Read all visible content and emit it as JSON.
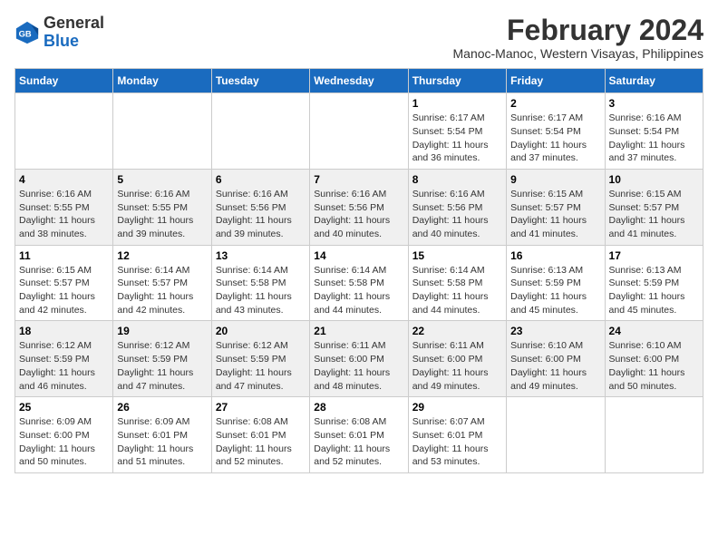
{
  "logo": {
    "general": "General",
    "blue": "Blue"
  },
  "header": {
    "month_year": "February 2024",
    "location": "Manoc-Manoc, Western Visayas, Philippines"
  },
  "weekdays": [
    "Sunday",
    "Monday",
    "Tuesday",
    "Wednesday",
    "Thursday",
    "Friday",
    "Saturday"
  ],
  "weeks": [
    [
      {
        "day": "",
        "info": ""
      },
      {
        "day": "",
        "info": ""
      },
      {
        "day": "",
        "info": ""
      },
      {
        "day": "",
        "info": ""
      },
      {
        "day": "1",
        "info": "Sunrise: 6:17 AM\nSunset: 5:54 PM\nDaylight: 11 hours\nand 36 minutes."
      },
      {
        "day": "2",
        "info": "Sunrise: 6:17 AM\nSunset: 5:54 PM\nDaylight: 11 hours\nand 37 minutes."
      },
      {
        "day": "3",
        "info": "Sunrise: 6:16 AM\nSunset: 5:54 PM\nDaylight: 11 hours\nand 37 minutes."
      }
    ],
    [
      {
        "day": "4",
        "info": "Sunrise: 6:16 AM\nSunset: 5:55 PM\nDaylight: 11 hours\nand 38 minutes."
      },
      {
        "day": "5",
        "info": "Sunrise: 6:16 AM\nSunset: 5:55 PM\nDaylight: 11 hours\nand 39 minutes."
      },
      {
        "day": "6",
        "info": "Sunrise: 6:16 AM\nSunset: 5:56 PM\nDaylight: 11 hours\nand 39 minutes."
      },
      {
        "day": "7",
        "info": "Sunrise: 6:16 AM\nSunset: 5:56 PM\nDaylight: 11 hours\nand 40 minutes."
      },
      {
        "day": "8",
        "info": "Sunrise: 6:16 AM\nSunset: 5:56 PM\nDaylight: 11 hours\nand 40 minutes."
      },
      {
        "day": "9",
        "info": "Sunrise: 6:15 AM\nSunset: 5:57 PM\nDaylight: 11 hours\nand 41 minutes."
      },
      {
        "day": "10",
        "info": "Sunrise: 6:15 AM\nSunset: 5:57 PM\nDaylight: 11 hours\nand 41 minutes."
      }
    ],
    [
      {
        "day": "11",
        "info": "Sunrise: 6:15 AM\nSunset: 5:57 PM\nDaylight: 11 hours\nand 42 minutes."
      },
      {
        "day": "12",
        "info": "Sunrise: 6:14 AM\nSunset: 5:57 PM\nDaylight: 11 hours\nand 42 minutes."
      },
      {
        "day": "13",
        "info": "Sunrise: 6:14 AM\nSunset: 5:58 PM\nDaylight: 11 hours\nand 43 minutes."
      },
      {
        "day": "14",
        "info": "Sunrise: 6:14 AM\nSunset: 5:58 PM\nDaylight: 11 hours\nand 44 minutes."
      },
      {
        "day": "15",
        "info": "Sunrise: 6:14 AM\nSunset: 5:58 PM\nDaylight: 11 hours\nand 44 minutes."
      },
      {
        "day": "16",
        "info": "Sunrise: 6:13 AM\nSunset: 5:59 PM\nDaylight: 11 hours\nand 45 minutes."
      },
      {
        "day": "17",
        "info": "Sunrise: 6:13 AM\nSunset: 5:59 PM\nDaylight: 11 hours\nand 45 minutes."
      }
    ],
    [
      {
        "day": "18",
        "info": "Sunrise: 6:12 AM\nSunset: 5:59 PM\nDaylight: 11 hours\nand 46 minutes."
      },
      {
        "day": "19",
        "info": "Sunrise: 6:12 AM\nSunset: 5:59 PM\nDaylight: 11 hours\nand 47 minutes."
      },
      {
        "day": "20",
        "info": "Sunrise: 6:12 AM\nSunset: 5:59 PM\nDaylight: 11 hours\nand 47 minutes."
      },
      {
        "day": "21",
        "info": "Sunrise: 6:11 AM\nSunset: 6:00 PM\nDaylight: 11 hours\nand 48 minutes."
      },
      {
        "day": "22",
        "info": "Sunrise: 6:11 AM\nSunset: 6:00 PM\nDaylight: 11 hours\nand 49 minutes."
      },
      {
        "day": "23",
        "info": "Sunrise: 6:10 AM\nSunset: 6:00 PM\nDaylight: 11 hours\nand 49 minutes."
      },
      {
        "day": "24",
        "info": "Sunrise: 6:10 AM\nSunset: 6:00 PM\nDaylight: 11 hours\nand 50 minutes."
      }
    ],
    [
      {
        "day": "25",
        "info": "Sunrise: 6:09 AM\nSunset: 6:00 PM\nDaylight: 11 hours\nand 50 minutes."
      },
      {
        "day": "26",
        "info": "Sunrise: 6:09 AM\nSunset: 6:01 PM\nDaylight: 11 hours\nand 51 minutes."
      },
      {
        "day": "27",
        "info": "Sunrise: 6:08 AM\nSunset: 6:01 PM\nDaylight: 11 hours\nand 52 minutes."
      },
      {
        "day": "28",
        "info": "Sunrise: 6:08 AM\nSunset: 6:01 PM\nDaylight: 11 hours\nand 52 minutes."
      },
      {
        "day": "29",
        "info": "Sunrise: 6:07 AM\nSunset: 6:01 PM\nDaylight: 11 hours\nand 53 minutes."
      },
      {
        "day": "",
        "info": ""
      },
      {
        "day": "",
        "info": ""
      }
    ]
  ]
}
